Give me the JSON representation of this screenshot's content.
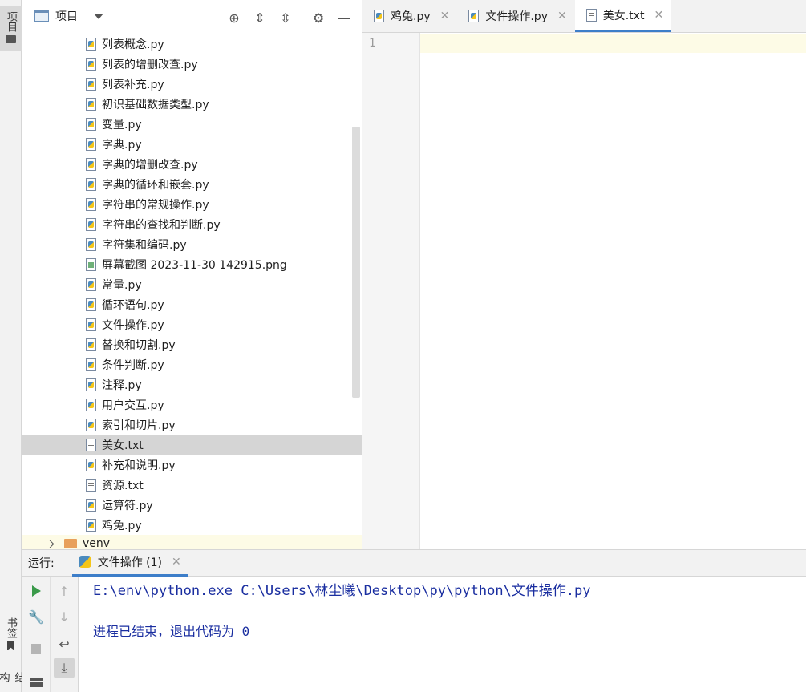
{
  "sidebar_tabs": {
    "project": "项目",
    "bookmarks": "书签",
    "structure": "结构"
  },
  "project_panel": {
    "title": "项目",
    "files": [
      {
        "name": "列表概念.py",
        "type": "py"
      },
      {
        "name": "列表的增删改查.py",
        "type": "py"
      },
      {
        "name": "列表补充.py",
        "type": "py"
      },
      {
        "name": "初识基础数据类型.py",
        "type": "py"
      },
      {
        "name": "变量.py",
        "type": "py"
      },
      {
        "name": "字典.py",
        "type": "py"
      },
      {
        "name": "字典的增删改查.py",
        "type": "py"
      },
      {
        "name": "字典的循环和嵌套.py",
        "type": "py"
      },
      {
        "name": "字符串的常规操作.py",
        "type": "py"
      },
      {
        "name": "字符串的查找和判断.py",
        "type": "py"
      },
      {
        "name": "字符集和编码.py",
        "type": "py"
      },
      {
        "name": "屏幕截图 2023-11-30 142915.png",
        "type": "png"
      },
      {
        "name": "常量.py",
        "type": "py"
      },
      {
        "name": "循环语句.py",
        "type": "py"
      },
      {
        "name": "文件操作.py",
        "type": "py"
      },
      {
        "name": "替换和切割.py",
        "type": "py"
      },
      {
        "name": "条件判断.py",
        "type": "py"
      },
      {
        "name": "注释.py",
        "type": "py"
      },
      {
        "name": "用户交互.py",
        "type": "py"
      },
      {
        "name": "索引和切片.py",
        "type": "py"
      },
      {
        "name": "美女.txt",
        "type": "txt",
        "selected": true
      },
      {
        "name": "补充和说明.py",
        "type": "py"
      },
      {
        "name": "资源.txt",
        "type": "txt"
      },
      {
        "name": "运算符.py",
        "type": "py"
      },
      {
        "name": "鸡兔.py",
        "type": "py"
      }
    ],
    "folder": "venv"
  },
  "editor": {
    "tabs": [
      {
        "label": "鸡兔.py",
        "type": "py"
      },
      {
        "label": "文件操作.py",
        "type": "py"
      },
      {
        "label": "美女.txt",
        "type": "txt",
        "active": true
      }
    ],
    "line_number": "1"
  },
  "run_panel": {
    "label": "运行:",
    "tab_label": "文件操作 (1)",
    "command": "E:\\env\\python.exe C:\\Users\\林尘曦\\Desktop\\py\\python\\文件操作.py",
    "exit_message": "进程已结束，退出代码为 0"
  },
  "colors": {
    "accent": "#3d7ec9",
    "console_text": "#1a2ea0",
    "run_green": "#3a9a4a"
  }
}
